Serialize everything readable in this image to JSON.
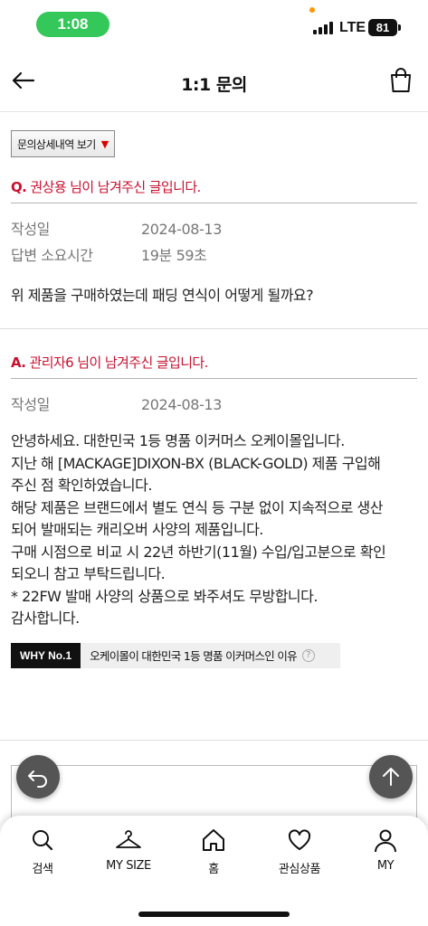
{
  "status_bar": {
    "time": "1:08",
    "network": "LTE",
    "battery": "81"
  },
  "header": {
    "title": "1:1 문의"
  },
  "question": {
    "detail_select_label": "문의상세내역 보기",
    "title_prefix": "Q.",
    "title_text": " 권상용 님이 남겨주신 글입니다.",
    "meta": [
      {
        "label": "작성일",
        "value": "2024-08-13"
      },
      {
        "label": "답변 소요시간",
        "value": "19분 59초"
      }
    ],
    "body": "위 제품을 구매하였는데 패딩 연식이 어떻게 될까요?"
  },
  "answer": {
    "title_prefix": "A.",
    "title_text": " 관리자6 님이 남겨주신 글입니다.",
    "meta": [
      {
        "label": "작성일",
        "value": "2024-08-13"
      }
    ],
    "body_lines": [
      "안녕하세요. 대한민국 1등 명품 이커머스 오케이몰입니다.",
      "지난 해 [MACKAGE]DIXON-BX (BLACK-GOLD) 제품 구입해",
      "주신 점 확인하였습니다.",
      "해당 제품은 브랜드에서 별도 연식 등 구분 없이 지속적으로 생산",
      "되어 발매되는 캐리오버 사양의 제품입니다.",
      "구매 시점으로 비교 시 22년 하반기(11월) 수입/입고분으로 확인",
      "되오니 참고 부탁드립니다.",
      "* 22FW 발매 사양의 상품으로 봐주셔도 무방합니다.",
      "감사합니다."
    ]
  },
  "why_banner": {
    "badge": "WHY No.1",
    "text": "오케이몰이 대한민국 1등 명품 이커머스인 이유",
    "help": "?"
  },
  "bottom_nav": [
    {
      "label": "검색",
      "icon": "search-icon"
    },
    {
      "label": "MY SIZE",
      "icon": "hanger-icon"
    },
    {
      "label": "홈",
      "icon": "home-icon"
    },
    {
      "label": "관심상품",
      "icon": "heart-icon"
    },
    {
      "label": "MY",
      "icon": "person-icon"
    }
  ],
  "colors": {
    "accent": "#c8102e",
    "status_pill": "#34c759"
  }
}
